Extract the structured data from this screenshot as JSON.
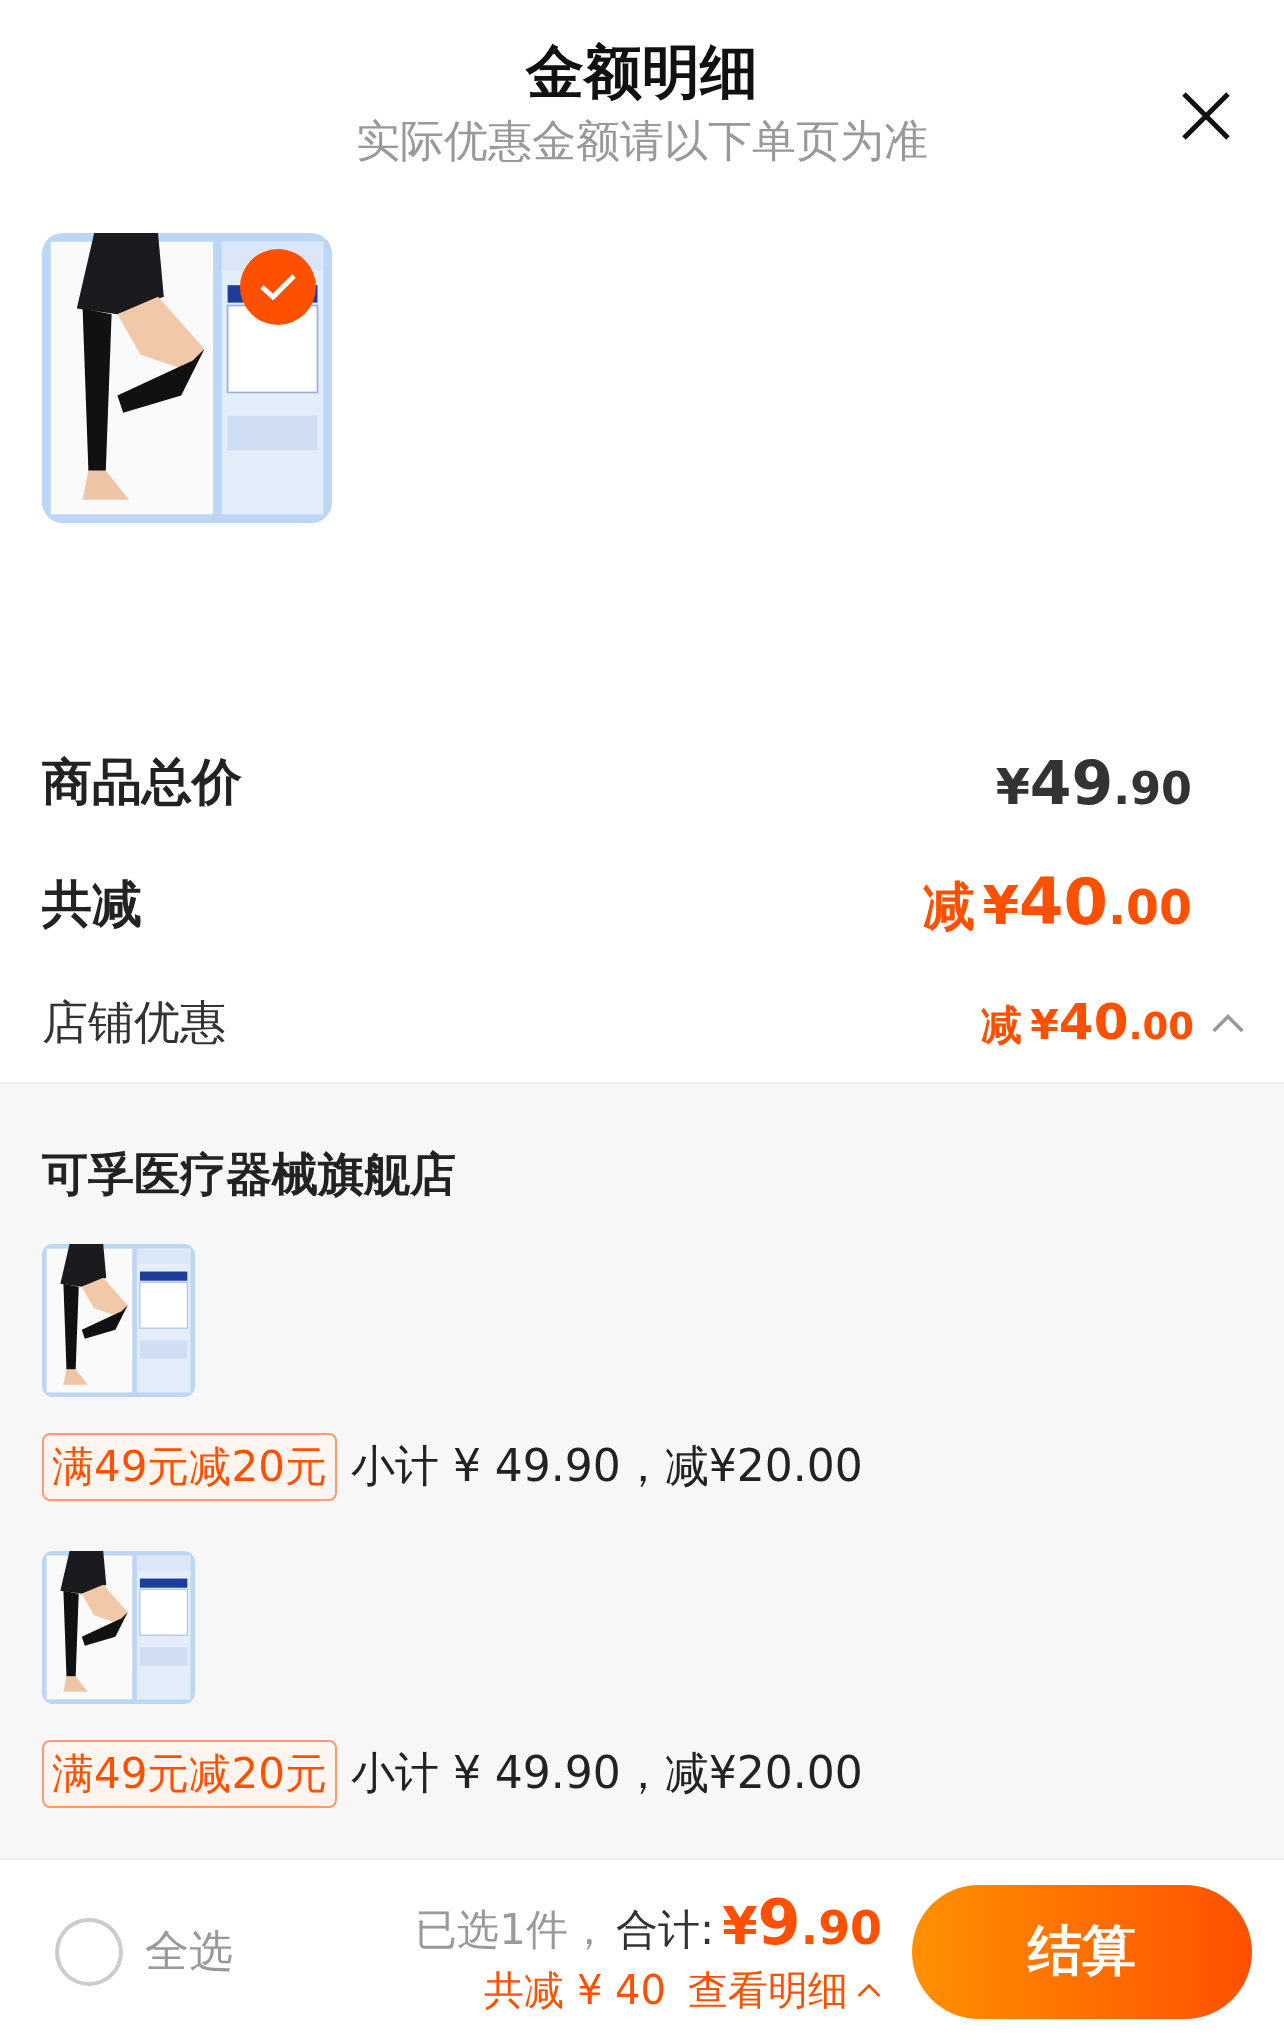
{
  "header": {
    "title": "金额明细",
    "subtitle": "实际优惠金额请以下单页为准"
  },
  "selected_products": [
    {
      "kind": "picture",
      "selected": true
    }
  ],
  "summary": [
    {
      "kind": "total",
      "label": "商品总价",
      "currency": "¥",
      "integer": "49",
      "decimal": ".90"
    },
    {
      "kind": "discount",
      "label": "共减",
      "prefix": "减",
      "currency": "¥",
      "integer": "40",
      "decimal": ".00"
    }
  ],
  "store_discount": {
    "label": "店铺优惠",
    "prefix": "减",
    "currency": "¥",
    "integer": "40",
    "decimal": ".00",
    "expanded": true
  },
  "store": {
    "name": "可孚医疗器械旗舰店",
    "items": [
      {
        "coupon": "满49元减20元",
        "subtotal": "小计 ¥ 49.90，减¥20.00"
      },
      {
        "coupon": "满49元减20元",
        "subtotal": "小计 ¥ 49.90，减¥20.00"
      }
    ]
  },
  "footer": {
    "select_all": {
      "label": "全选",
      "checked": false
    },
    "selected_count": "已选1件，",
    "total_label": "合计:",
    "currency": "¥",
    "integer": "9",
    "decimal": ".90",
    "discount_summary": "共减 ¥ 40",
    "details_link": "查看明细",
    "checkout": "结算"
  }
}
